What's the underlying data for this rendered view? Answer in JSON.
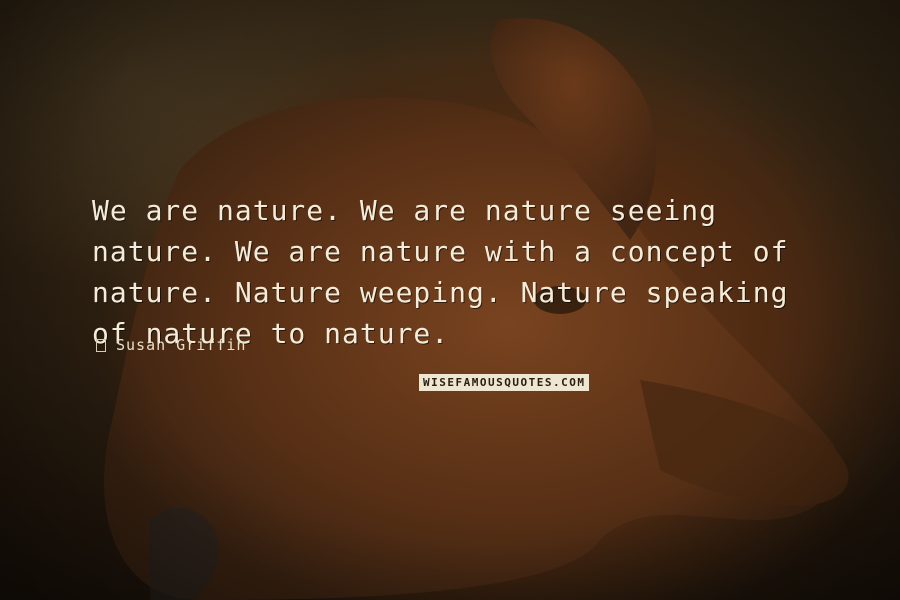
{
  "quote": {
    "text": "We are nature. We are nature seeing nature. We are nature with a concept of nature. Nature weeping. Nature speaking of nature to nature.",
    "author": "Susan Griffin"
  },
  "watermark": {
    "text": "WISEFAMOUSQUOTES.COM"
  },
  "background": {
    "subject": "brown-dog-photo",
    "colors": {
      "fur": "#6a3a1a",
      "shadow": "#2a1d10",
      "text": "#f4ecd9"
    }
  }
}
